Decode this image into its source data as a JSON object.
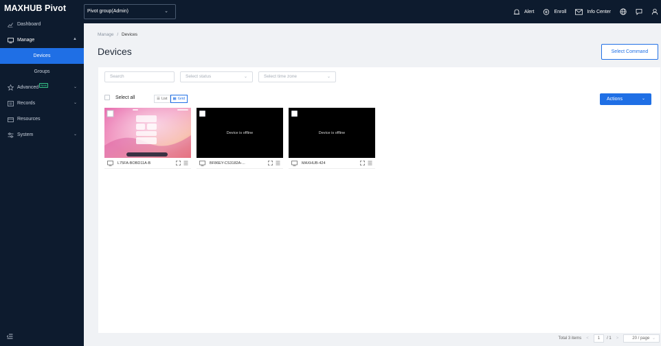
{
  "app": {
    "logo": "MAXHUB Pivot"
  },
  "topbar": {
    "group_select": "Pivot group(Admin)",
    "alert": "Alert",
    "enroll": "Enroll",
    "info_center": "Info Center"
  },
  "sidebar": {
    "dashboard": "Dashboard",
    "manage": "Manage",
    "devices": "Devices",
    "groups": "Groups",
    "advanced": "Advanced",
    "advanced_badge": "New",
    "records": "Records",
    "resources": "Resources",
    "system": "System"
  },
  "main": {
    "breadcrumb_parent": "Manage",
    "breadcrumb_sep": "/",
    "breadcrumb_current": "Devices",
    "title": "Devices",
    "select_command": "Select Command",
    "filters": {
      "search_placeholder": "Search",
      "status_placeholder": "Select status",
      "timezone_placeholder": "Select time zone"
    },
    "select_all": "Select all",
    "view_list": "List",
    "view_grid": "Grid",
    "actions": "Actions",
    "devices": [
      {
        "name": "L75FA-BOBD11A-B",
        "status": "online",
        "offline_text": ""
      },
      {
        "name": "BF86EY-CS3182A-...",
        "status": "offline",
        "offline_text": "Device is offline"
      },
      {
        "name": "MAXHUB-424",
        "status": "offline",
        "offline_text": "Device is offline"
      }
    ],
    "pagination": {
      "total": "Total 3 items",
      "current": "1",
      "of": "/ 1",
      "page_size": "20 / page"
    }
  },
  "colors": {
    "sidebar_bg": "#0d1b2e",
    "accent": "#1f6fe5"
  }
}
